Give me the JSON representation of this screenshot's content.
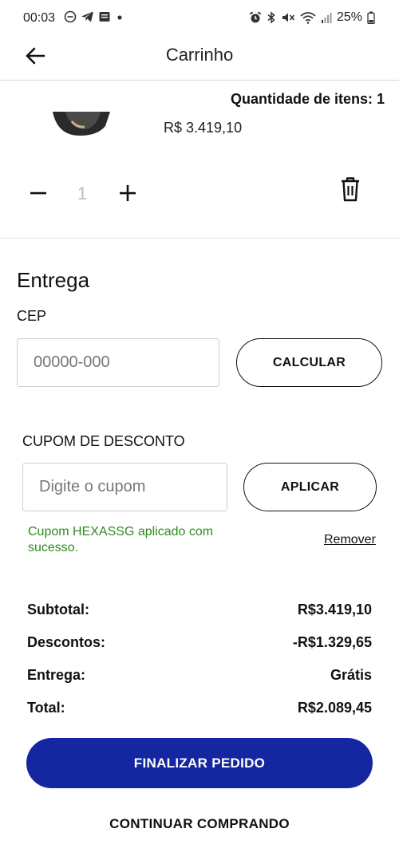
{
  "status_bar": {
    "time": "00:03",
    "battery": "25%",
    "left_icons": [
      "minus-circle-icon",
      "telegram-icon",
      "message-icon",
      "dot-icon"
    ],
    "right_icons": [
      "alarm-icon",
      "bluetooth-icon",
      "mute-icon",
      "wifi-icon",
      "signal-icon",
      "battery-icon"
    ]
  },
  "header": {
    "title": "Carrinho",
    "back_icon": "arrow-left-icon"
  },
  "cart": {
    "quantity_items_label": "Quantidade de itens: 1",
    "product_price": "R$ 3.419,10",
    "quantity": "1",
    "minus_icon": "minus-icon",
    "plus_icon": "plus-icon",
    "delete_icon": "trash-icon"
  },
  "delivery": {
    "title": "Entrega",
    "cep_label": "CEP",
    "cep_placeholder": "00000-000",
    "calculate_label": "CALCULAR"
  },
  "coupon": {
    "label": "CUPOM DE DESCONTO",
    "placeholder": "Digite o cupom",
    "apply_label": "APLICAR",
    "success_message": "Cupom HEXASSG aplicado com sucesso.",
    "remove_label": "Remover",
    "success_color": "#2e8b1e"
  },
  "summary": {
    "subtotal_label": "Subtotal:",
    "subtotal_value": "R$3.419,10",
    "discount_label": "Descontos:",
    "discount_value": "-R$1.329,65",
    "shipping_label": "Entrega:",
    "shipping_value": "Grátis",
    "total_label": "Total:",
    "total_value": "R$2.089,45"
  },
  "actions": {
    "finalize_label": "FINALIZAR PEDIDO",
    "continue_label": "CONTINUAR COMPRANDO",
    "primary_color": "#1527a0"
  }
}
